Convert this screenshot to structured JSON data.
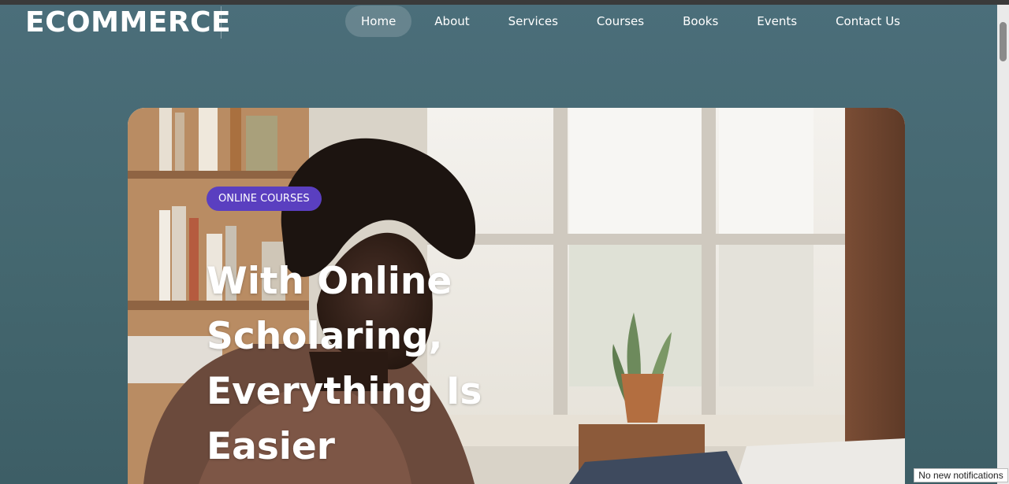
{
  "brand": {
    "logo_text": "ECOMMERCE"
  },
  "nav": {
    "items": [
      {
        "label": "Home",
        "active": true
      },
      {
        "label": "About"
      },
      {
        "label": "Services"
      },
      {
        "label": "Courses"
      },
      {
        "label": "Books"
      },
      {
        "label": "Events"
      },
      {
        "label": "Contact Us"
      }
    ]
  },
  "hero": {
    "badge": "ONLINE COURSES",
    "headline": "With Online Scholaring, Everything Is Easier",
    "image_subject": "student-at-window-photo",
    "badge_color": "#5a3fc0"
  },
  "status": {
    "notifications": "No new notifications"
  },
  "colors": {
    "page_background": "#47696f",
    "text": "#ffffff"
  }
}
